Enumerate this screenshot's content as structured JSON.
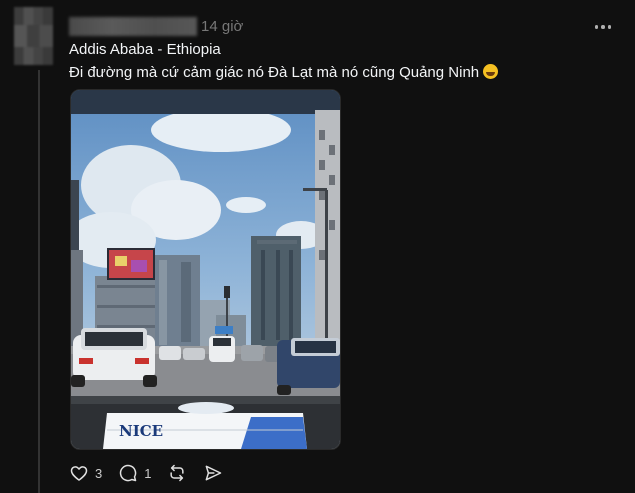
{
  "post": {
    "timestamp": "14 giờ",
    "location": "Addis Ababa - Ethiopia",
    "text": "Đi đường mà cứ cảm giác nó Đà Lạt mà nó cũng Quảng Ninh",
    "emoji": "rolling-on-floor-laughing",
    "photo": {
      "brand_text": "NICE"
    }
  },
  "actions": {
    "likes": "3",
    "comments": "1"
  },
  "colors": {
    "background": "#101010",
    "text": "#f3f5f7",
    "muted": "#777777"
  },
  "icons": [
    "more-icon",
    "heart-icon",
    "comment-icon",
    "repost-icon",
    "share-icon"
  ]
}
